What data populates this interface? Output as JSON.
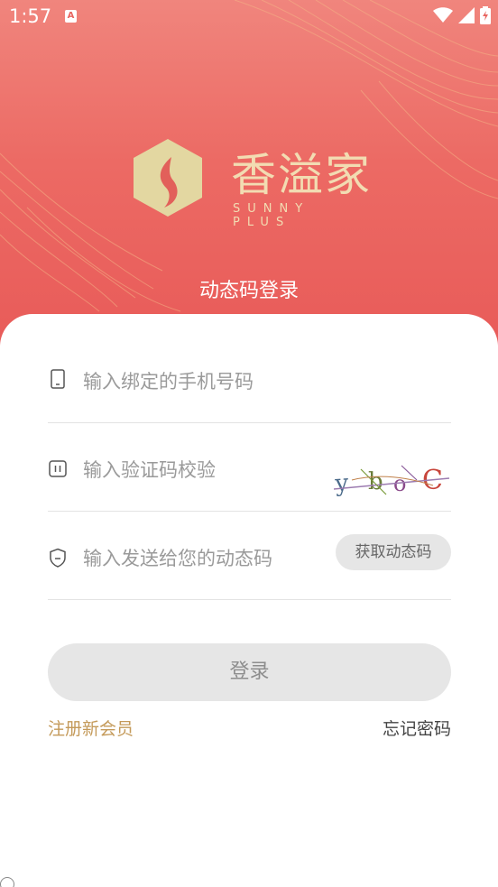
{
  "status_bar": {
    "time": "1:57",
    "notification_icon": "a-icon",
    "icons": [
      "wifi-icon",
      "signal-icon",
      "battery-icon"
    ]
  },
  "brand": {
    "name_cn": "香溢家",
    "name_en": "SUNNY PLUS",
    "logo_icon": "flame-hexagon-icon"
  },
  "page_title": "动态码登录",
  "form": {
    "phone": {
      "placeholder": "输入绑定的手机号码",
      "icon": "phone-icon"
    },
    "captcha": {
      "placeholder": "输入验证码校验",
      "icon": "pause-box-icon",
      "captcha_image_text": "ybOC"
    },
    "otp": {
      "placeholder": "输入发送给您的动态码",
      "icon": "shield-icon",
      "send_label": "获取动态码"
    },
    "login_label": "登录"
  },
  "links": {
    "register": "注册新会员",
    "forgot": "忘记密码"
  },
  "colors": {
    "hero_top": "#f0857d",
    "hero_bottom": "#e85a58",
    "brand_gold": "#f2dcb2",
    "link_gold": "#c49a5a",
    "button_gray": "#e6e6e6"
  }
}
